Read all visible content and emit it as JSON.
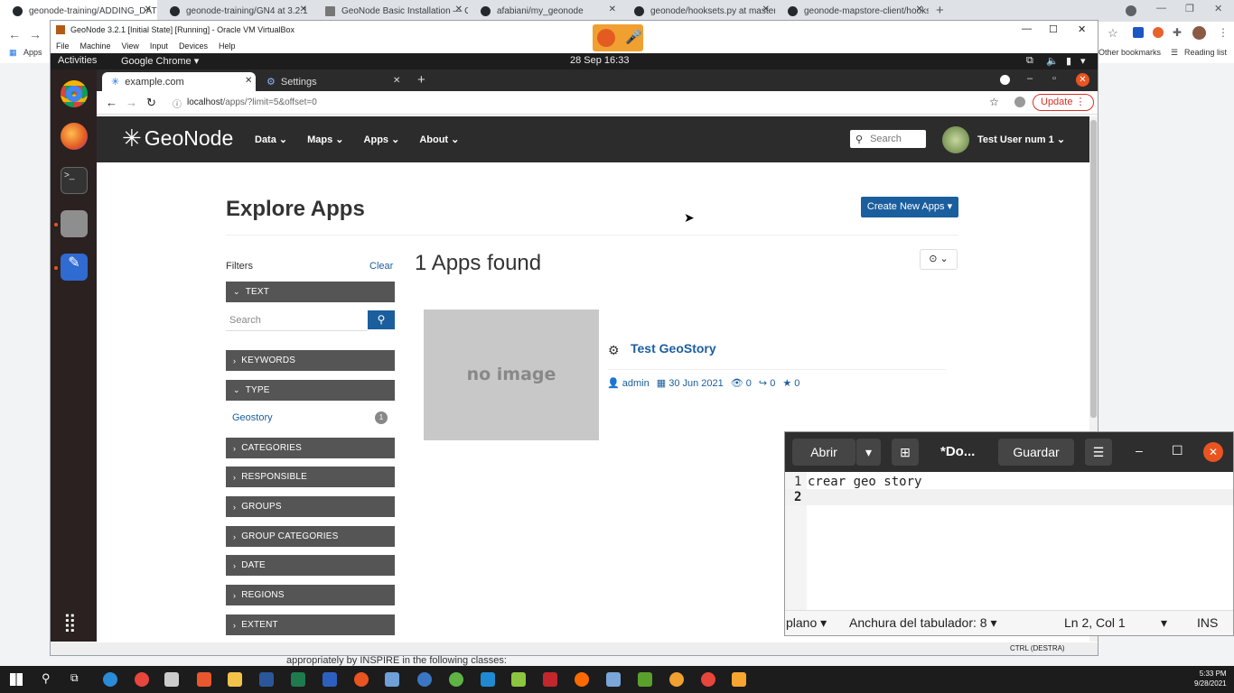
{
  "host": {
    "tabs": [
      {
        "title": "geonode-training/ADDING_DAT"
      },
      {
        "title": "geonode-training/GN4 at 3.2.1"
      },
      {
        "title": "GeoNode Basic Installation — Ge"
      },
      {
        "title": "afabiani/my_geonode"
      },
      {
        "title": "geonode/hooksets.py at master"
      },
      {
        "title": "geonode-mapstore-client/hooks"
      }
    ],
    "new_tab": "+",
    "bookmarks": {
      "apps": "Apps",
      "other": "Other bookmarks",
      "reading": "Reading list"
    }
  },
  "vm": {
    "title": "GeoNode 3.2.1 [Initial State] [Running] - Oracle VM VirtualBox",
    "menu": [
      "File",
      "Machine",
      "View",
      "Input",
      "Devices",
      "Help"
    ],
    "status": "CTRL (DESTRA)",
    "under_text": "appropriately by INSPIRE in the following classes:"
  },
  "ubuntu": {
    "activities": "Activities",
    "app": "Google Chrome",
    "clock": "28 Sep  16:33"
  },
  "guest": {
    "tabs": [
      {
        "title": "example.com"
      },
      {
        "title": "Settings"
      }
    ],
    "url_host": "localhost",
    "url_path": "/apps/?limit=5&offset=0",
    "update_label": "Update"
  },
  "geonode": {
    "brand": "GeoNode",
    "nav": [
      "Data",
      "Maps",
      "Apps",
      "About"
    ],
    "search_placeholder": "Search",
    "user": "Test User num 1",
    "page_title": "Explore Apps",
    "create_button": "Create New Apps",
    "filters_label": "Filters",
    "clear_label": "Clear",
    "filter_search_placeholder": "Search",
    "results_heading": "1 Apps found",
    "filters": [
      {
        "label": "TEXT"
      },
      {
        "label": "KEYWORDS"
      },
      {
        "label": "TYPE"
      },
      {
        "label": "CATEGORIES"
      },
      {
        "label": "RESPONSIBLE"
      },
      {
        "label": "GROUPS"
      },
      {
        "label": "GROUP CATEGORIES"
      },
      {
        "label": "DATE"
      },
      {
        "label": "REGIONS"
      },
      {
        "label": "EXTENT"
      }
    ],
    "type_option": {
      "label": "Geostory",
      "count": "1"
    },
    "app": {
      "thumb": "no image",
      "title": "Test GeoStory",
      "owner": "admin",
      "date": "30 Jun 2021",
      "views": "0",
      "shares": "0",
      "favorites": "0"
    }
  },
  "gedit": {
    "open": "Abrir",
    "title": "*Do...",
    "save": "Guardar",
    "lines": [
      {
        "n": "1",
        "text": "crear geo story"
      },
      {
        "n": "2",
        "text": ""
      }
    ],
    "status": {
      "mode": "plano",
      "tab": "Anchura del tabulador: 8",
      "pos": "Ln 2, Col 1",
      "ins": "INS"
    }
  },
  "taskbar": {
    "time": "5:33 PM",
    "date": "9/28/2021"
  }
}
